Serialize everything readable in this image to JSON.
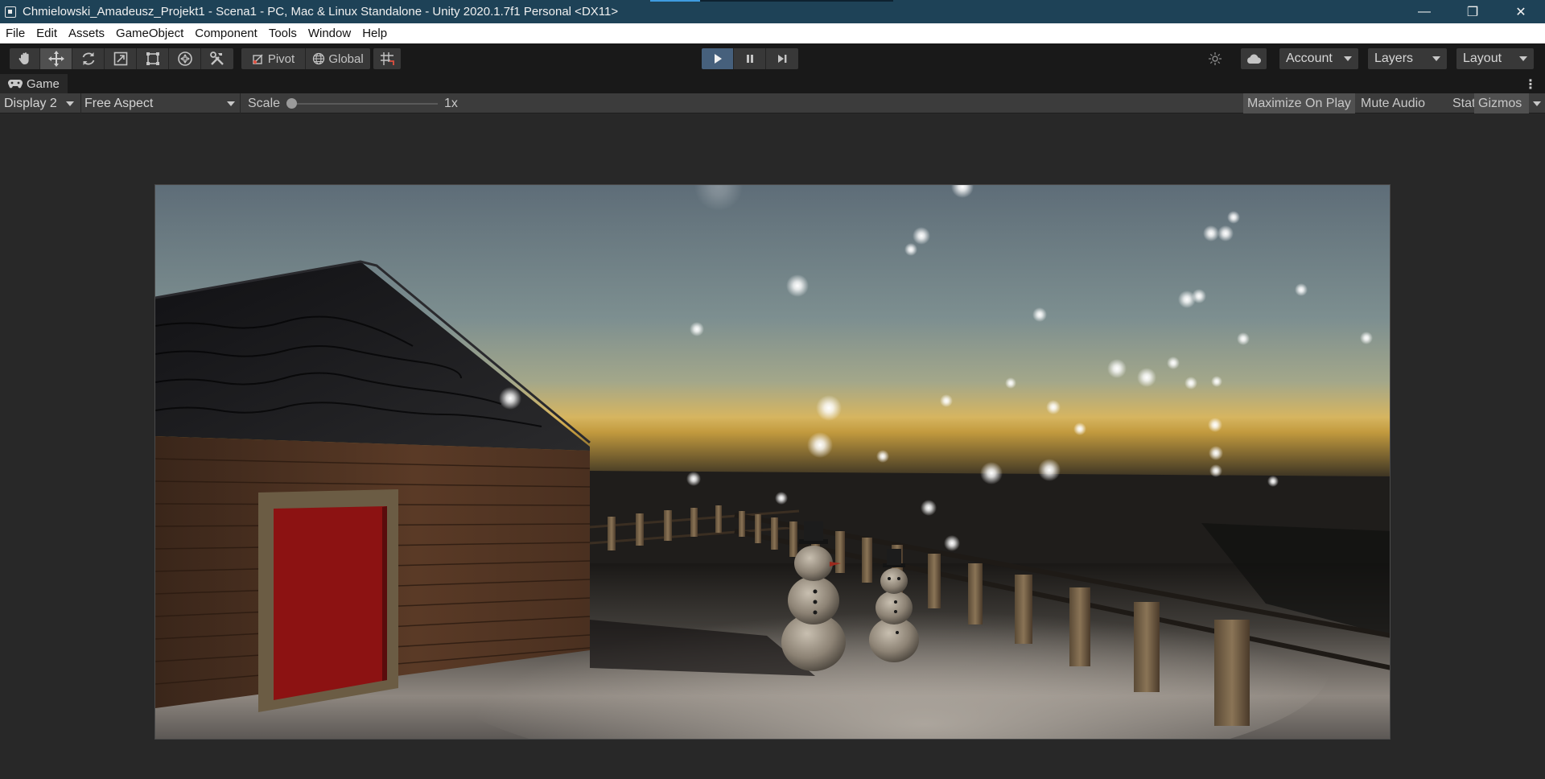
{
  "window": {
    "title": "Chmielowski_Amadeusz_Projekt1 - Scena1 - PC, Mac & Linux Standalone - Unity 2020.1.7f1 Personal <DX11>",
    "minimize_glyph": "—",
    "maximize_glyph": "❐",
    "close_glyph": "✕"
  },
  "menu": {
    "items": [
      "File",
      "Edit",
      "Assets",
      "GameObject",
      "Component",
      "Tools",
      "Window",
      "Help"
    ]
  },
  "toolbar": {
    "tools": [
      {
        "name": "hand-tool",
        "icon": "hand-icon"
      },
      {
        "name": "move-tool",
        "icon": "move-icon",
        "selected": true
      },
      {
        "name": "rotate-tool",
        "icon": "rotate-icon"
      },
      {
        "name": "scale-tool",
        "icon": "scale-icon"
      },
      {
        "name": "rect-tool",
        "icon": "rect-transform-icon"
      },
      {
        "name": "transform-tool",
        "icon": "transform-icon"
      },
      {
        "name": "custom-tool",
        "icon": "tools-icon"
      }
    ],
    "pivot_label": "Pivot",
    "global_label": "Global",
    "play_state": "playing",
    "account_label": "Account",
    "layers_label": "Layers",
    "layout_label": "Layout",
    "colors": {
      "play_active": "#46607c",
      "button": "#383838",
      "background": "#191919"
    }
  },
  "panel": {
    "tab_label": "Game",
    "menu_glyph": "⋮"
  },
  "game_controls": {
    "display": "Display 2",
    "aspect": "Free Aspect",
    "scale_label": "Scale",
    "scale_value": "1x",
    "scale_fraction": 0.0,
    "maximize_on_play": "Maximize On Play",
    "mute_audio": "Mute Audio",
    "stats": "Stats",
    "gizmos": "Gizmos"
  },
  "scene": {
    "description_objects": [
      "sky",
      "barn",
      "red-door",
      "fence",
      "snowman-large",
      "snowman-small",
      "snowflakes",
      "snow-ground"
    ],
    "colors": {
      "sky_top": "#5e6d78",
      "sky_horizon": "#d6b560",
      "door": "#8c1212",
      "wood": "#5a3a26",
      "roof": "#1c1c1e",
      "snow": "#8a8580"
    }
  }
}
